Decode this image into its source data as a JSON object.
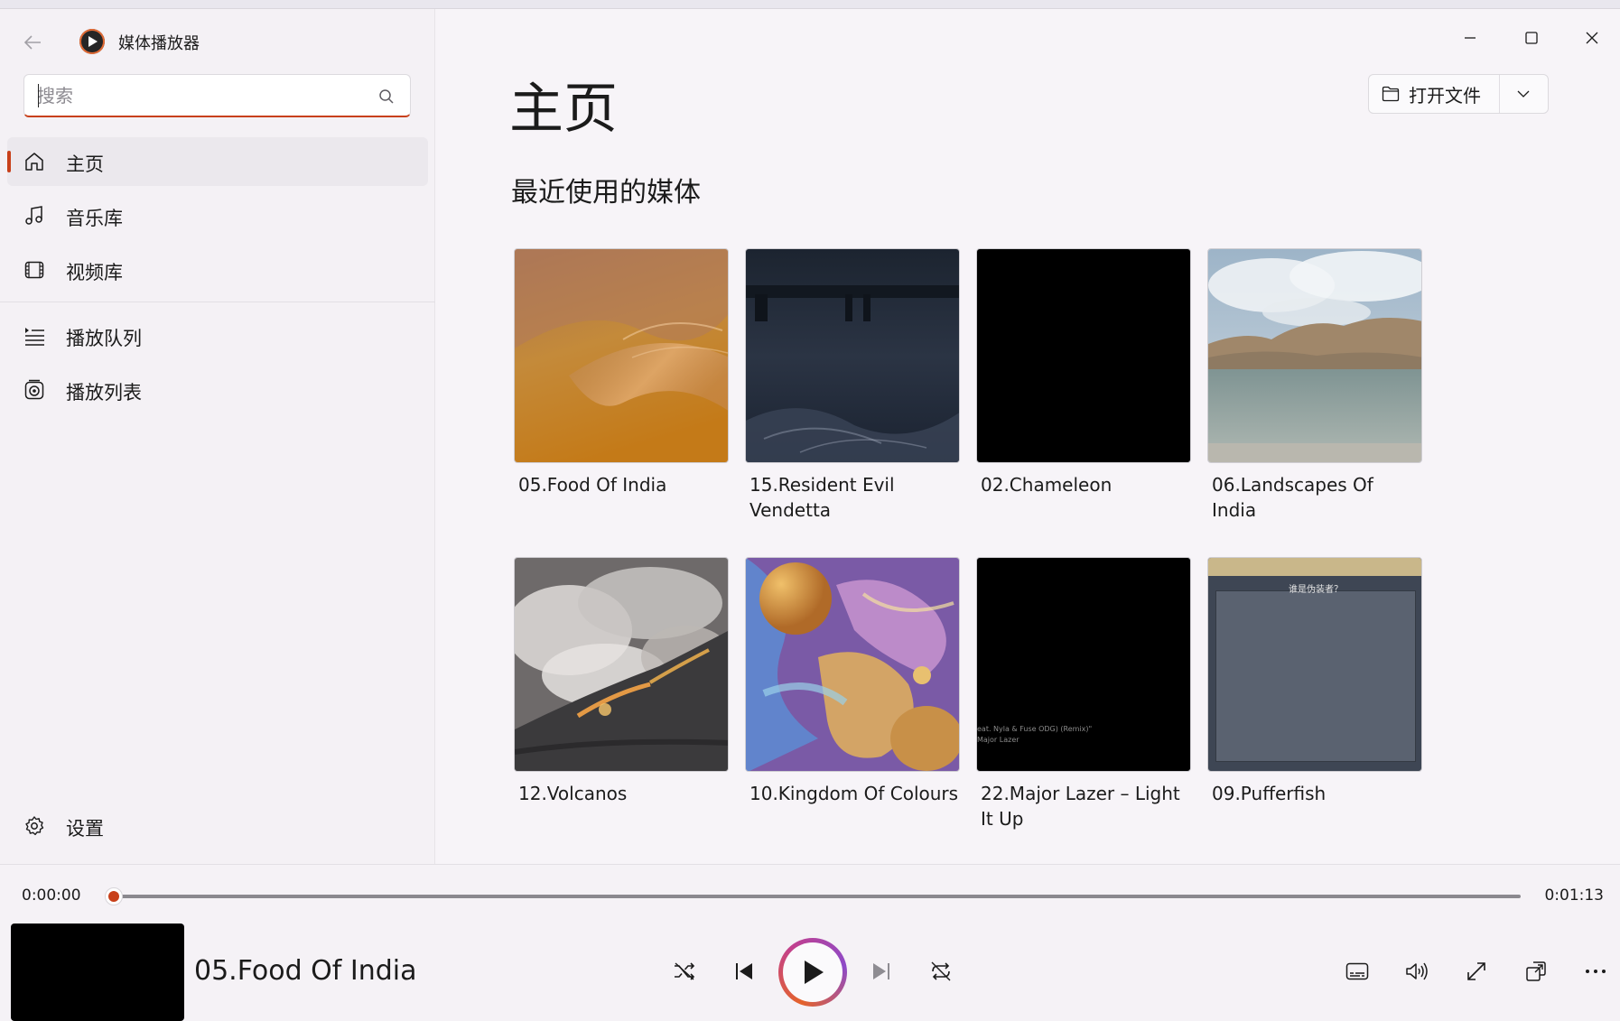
{
  "app": {
    "title": "媒体播放器"
  },
  "search": {
    "placeholder": "搜索"
  },
  "sidebar": {
    "items": [
      {
        "label": "主页",
        "icon": "home-icon",
        "active": true
      },
      {
        "label": "音乐库",
        "icon": "music-note-icon"
      },
      {
        "label": "视频库",
        "icon": "video-icon"
      },
      {
        "label": "播放队列",
        "icon": "queue-icon"
      },
      {
        "label": "播放列表",
        "icon": "playlist-icon"
      }
    ],
    "settings_label": "设置"
  },
  "main": {
    "title": "主页",
    "section_title": "最近使用的媒体",
    "open_file_label": "打开文件",
    "recent": [
      {
        "title": "05.Food Of India"
      },
      {
        "title": "15.Resident Evil Vendetta"
      },
      {
        "title": "02.Chameleon"
      },
      {
        "title": "06.Landscapes Of India"
      },
      {
        "title": "12.Volcanos"
      },
      {
        "title": "10.Kingdom Of Colours"
      },
      {
        "title": "22.Major Lazer – Light It Up",
        "thumb_text": "eat. Nyla & Fuse ODG) (Remix)\"\nMajor Lazer"
      },
      {
        "title": "09.Pufferfish",
        "thumb_text": "谁是伪装者？"
      }
    ]
  },
  "player": {
    "current_time": "0:00:00",
    "total_time": "0:01:13",
    "progress": 0,
    "now_playing": "05.Food Of India"
  },
  "colors": {
    "accent": "#c8401a"
  }
}
